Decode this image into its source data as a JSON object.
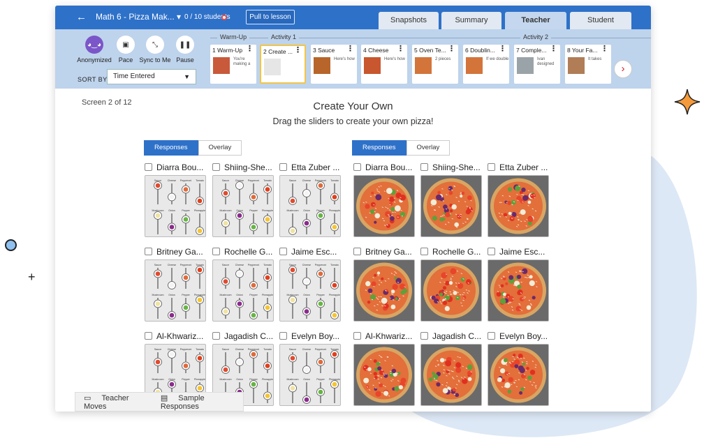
{
  "header": {
    "back_icon": "back-arrow-icon",
    "activity_name": "Math 6 - Pizza Mak... ▾",
    "students": "0 / 10 students",
    "pull_button": "Pull to lesson",
    "tabs": [
      "Snapshots",
      "Summary",
      "Teacher",
      "Student"
    ],
    "active_tab": "Teacher"
  },
  "controls": {
    "items": [
      {
        "label": "Anonymized",
        "icon": "anonymous-icon"
      },
      {
        "label": "Pace",
        "icon": "pace-icon"
      },
      {
        "label": "Sync to Me",
        "icon": "sync-icon"
      },
      {
        "label": "Pause",
        "icon": "pause-icon"
      }
    ],
    "sort_label": "SORT BY",
    "sort_value": "Time Entered"
  },
  "sections": [
    "Warm-Up",
    "Activity 1",
    "Activity 2"
  ],
  "screens": [
    {
      "label": "1 Warm-Up",
      "text": "You're making a"
    },
    {
      "label": "2 Create ...",
      "text": ""
    },
    {
      "label": "3 Sauce",
      "text": "Here's how"
    },
    {
      "label": "4 Cheese",
      "text": "Here's how"
    },
    {
      "label": "5 Oven Te...",
      "text": "2 pieces"
    },
    {
      "label": "6 Doublin...",
      "text": "If we double"
    },
    {
      "label": "7 Comple...",
      "text": "Ivan designed"
    },
    {
      "label": "8 Your Fa...",
      "text": "It takes"
    }
  ],
  "screen_counter": "Screen 2 of 12",
  "title": "Create Your Own",
  "subtitle": "Drag the sliders to create your own pizza!",
  "toggle": {
    "responses": "Responses",
    "overlay": "Overlay"
  },
  "students_list": [
    "Diarra Bou...",
    "Shiing-She...",
    "Etta Zuber ...",
    "Britney Ga...",
    "Rochelle G...",
    "Jaime Esc...",
    "Al-Khwariz...",
    "Jagadish C...",
    "Evelyn Boy..."
  ],
  "slider_labels": {
    "top": [
      "Sauce",
      "Cheese",
      "Pepperoni",
      "Tomato"
    ],
    "bottom": [
      "Mushroom",
      "Onion",
      "Pepper",
      "Pineapple"
    ]
  },
  "bottom_tabs": [
    "Teacher Moves",
    "Sample Responses"
  ]
}
